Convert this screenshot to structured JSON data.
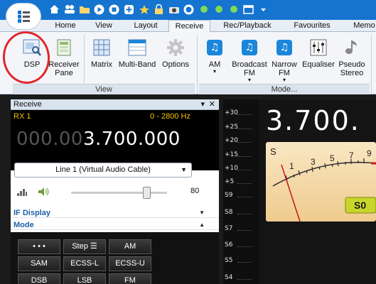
{
  "ribbon_tabs": [
    "Home",
    "View",
    "Layout",
    "Receive",
    "Rec/Playback",
    "Favourites",
    "Memo"
  ],
  "ribbon": {
    "dsp": "DSP",
    "receiver_pane": "Receiver Pane",
    "matrix": "Matrix",
    "multiband": "Multi-Band",
    "options": "Options",
    "view_group": "View",
    "am": "AM",
    "broadcast_fm": "Broadcast FM",
    "narrow_fm": "Narrow FM",
    "equaliser": "Equaliser",
    "pseudo_stereo": "Pseudo Stereo",
    "mode_group": "Mode...",
    "caret": "▾"
  },
  "panel": {
    "title": "Receive",
    "pin": "▾",
    "close": "✕",
    "rx_label": "RX 1",
    "bandwidth": "0 - 2800 Hz",
    "freq_dim": "000.00",
    "freq_lit": "3.700.000",
    "audio_device": "Line 1 (Virtual Audio Cable)",
    "volume": "80",
    "if_display": "IF Display",
    "mode": "Mode",
    "mode_buttons": [
      "• • •",
      "Step ☰",
      "AM",
      "SAM",
      "ECSS-L",
      "ECSS-U",
      "DSB",
      "LSB",
      "FM"
    ]
  },
  "scale_labels": [
    "+30",
    "+25",
    "+20",
    "+15",
    "+10",
    "+5",
    "S9",
    "S8",
    "S7",
    "S6",
    "S5",
    "S4"
  ],
  "meter": {
    "freq": "3.700.",
    "s_label": "S",
    "ticks": [
      "1",
      "3",
      "5",
      "7",
      "9"
    ],
    "readout": "S0"
  },
  "colors": {
    "titlebar": "#1574cf",
    "accent_yellow": "#f3c200",
    "section_blue": "#1f5fa8",
    "annotation_red": "#e0262b"
  }
}
